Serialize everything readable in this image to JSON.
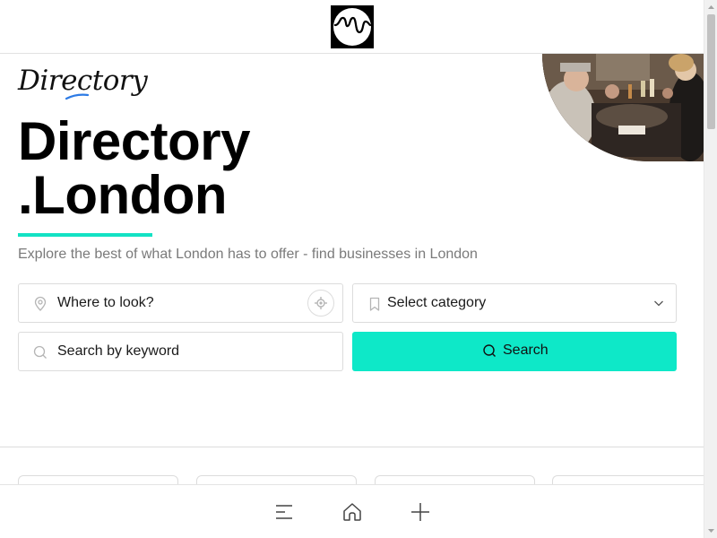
{
  "header": {
    "logo_icon": "river-thames-logo-icon"
  },
  "hero": {
    "script_logo": "Directory",
    "title_line1": "Directory",
    "title_line2": ".London",
    "subtitle": "Explore the best of what London has to offer - find businesses in London",
    "photo": "restaurant-diners-photo"
  },
  "search": {
    "where_placeholder": "Where to look?",
    "category_placeholder": "Select category",
    "keyword_placeholder": "Search by keyword",
    "search_label": "Search"
  },
  "bottom_nav": {
    "items": [
      "menu-icon",
      "home-icon",
      "plus-icon"
    ]
  },
  "colors": {
    "accent": "#0ee8c8",
    "subtitle_text": "#7a7a7a",
    "script_underline": "#2d7be5"
  }
}
